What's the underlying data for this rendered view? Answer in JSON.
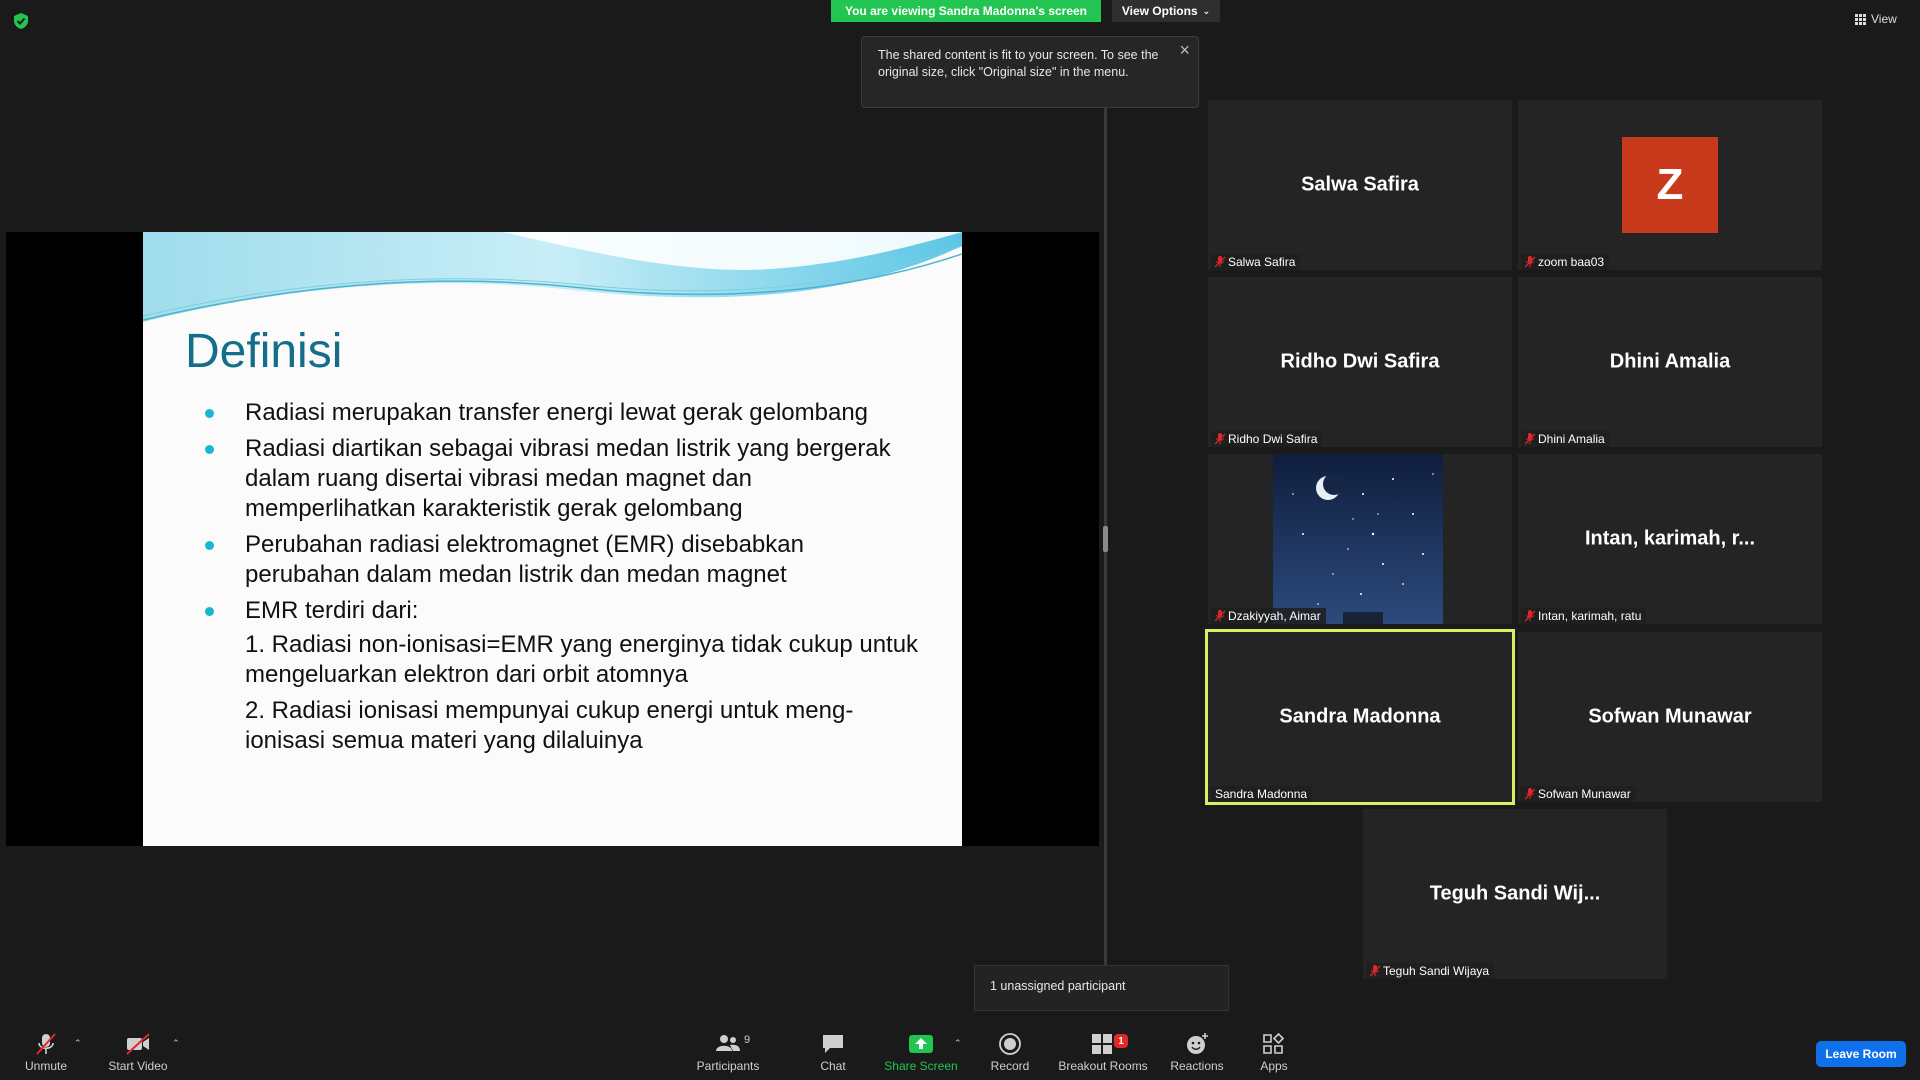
{
  "top": {
    "viewing_banner": "You are viewing Sandra Madonna's screen",
    "view_options_label": "View Options",
    "view_label": "View"
  },
  "tooltip": {
    "text": "The shared content is fit to your screen. To see the original size, click \"Original size\" in the menu."
  },
  "slide": {
    "title": "Definisi",
    "bullets": [
      "Radiasi merupakan transfer energi lewat gerak gelombang",
      "Radiasi diartikan sebagai vibrasi medan listrik yang bergerak dalam ruang disertai vibrasi medan magnet dan memperlihatkan karakteristik gerak gelombang",
      "Perubahan radiasi elektromagnet (EMR) disebabkan perubahan dalam medan listrik dan medan magnet",
      "EMR terdiri dari:"
    ],
    "sub_items": [
      "1. Radiasi non-ionisasi=EMR yang energinya tidak cukup untuk mengeluarkan elektron dari orbit atomnya",
      "2. Radiasi ionisasi mempunyai cukup energi untuk meng-ionisasi semua materi yang dilaluinya"
    ]
  },
  "participants": [
    {
      "display": "Salwa Safira",
      "name": "Salwa Safira",
      "muted": true
    },
    {
      "display": "Z",
      "name": "zoom baa03",
      "muted": true,
      "avatar_color": "#c9391c"
    },
    {
      "display": "Ridho Dwi Safira",
      "name": "Ridho Dwi Safira",
      "muted": true
    },
    {
      "display": "Dhini Amalia",
      "name": "Dhini Amalia",
      "muted": true
    },
    {
      "display": "",
      "name": "Dzakiyyah, Aimar",
      "muted": true
    },
    {
      "display": "Intan, karimah, r...",
      "name": "Intan, karimah, ratu",
      "muted": true
    },
    {
      "display": "Sandra Madonna",
      "name": "Sandra Madonna",
      "muted": false,
      "active_speaker": true
    },
    {
      "display": "Sofwan Munawar",
      "name": "Sofwan Munawar",
      "muted": true
    },
    {
      "display": "Teguh Sandi Wij...",
      "name": "Teguh Sandi Wijaya",
      "muted": true
    }
  ],
  "unassigned": "1 unassigned participant",
  "toolbar": {
    "unmute": "Unmute",
    "start_video": "Start Video",
    "participants": "Participants",
    "participants_count": "9",
    "chat": "Chat",
    "share_screen": "Share Screen",
    "record": "Record",
    "breakout_rooms": "Breakout Rooms",
    "breakout_badge": "1",
    "reactions": "Reactions",
    "apps": "Apps",
    "leave_room": "Leave Room"
  },
  "colors": {
    "share_green": "#23c552",
    "active_border": "#d6ef63",
    "leave_blue": "#0e71eb",
    "muted_red": "#e02828",
    "slide_title": "#136e8a",
    "bullet": "#1bb5d2"
  }
}
